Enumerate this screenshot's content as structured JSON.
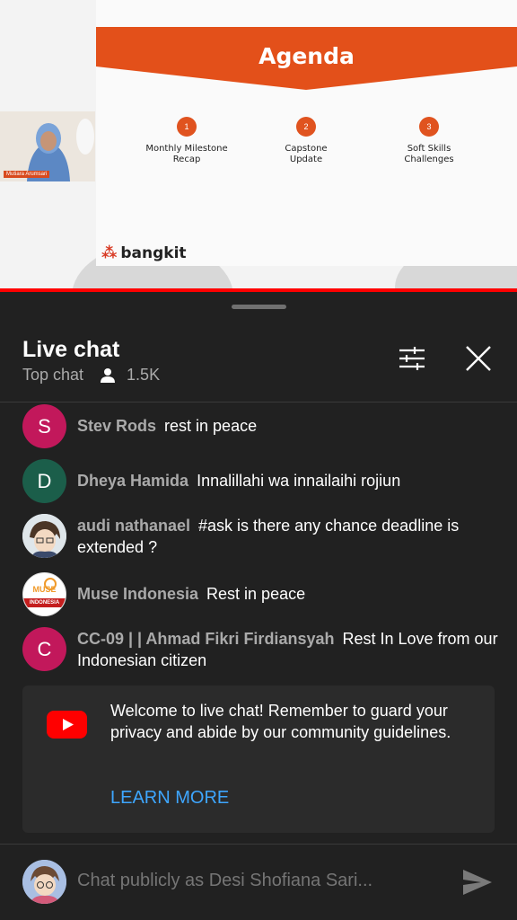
{
  "video": {
    "slide_title": "Agenda",
    "agenda_items": [
      {
        "num": "1",
        "label_line1": "Monthly Milestone",
        "label_line2": "Recap"
      },
      {
        "num": "2",
        "label_line1": "Capstone",
        "label_line2": "Update"
      },
      {
        "num": "3",
        "label_line1": "Soft Skills",
        "label_line2": "Challenges"
      }
    ],
    "brand_logo": "bangkit",
    "presenter_name": "Mutiara Arumsari",
    "accent_color": "#e0531f",
    "progress_color": "#ff0000"
  },
  "chat": {
    "title": "Live chat",
    "mode": "Top chat",
    "viewer_icon": "person-icon",
    "viewers": "1.5K",
    "filter_icon": "tune-icon",
    "close_icon": "close-icon",
    "messages": [
      {
        "initial": "S",
        "avatar_color": "#c2185b",
        "author": "Stev Rods",
        "text": "rest in peace"
      },
      {
        "initial": "D",
        "avatar_color": "#1b5e4a",
        "author": "Dheya Hamida",
        "text": "Innalillahi wa innailaihi rojiun"
      },
      {
        "initial": "",
        "avatar_color": "#cfd8dc",
        "author": "audi nathanael",
        "text": "#ask is there any chance deadline is extended ?"
      },
      {
        "initial": "MUSE",
        "avatar_color": "#ffffff",
        "author": "Muse Indonesia",
        "text": "Rest in peace",
        "avatar_sub": "INDONESIA"
      },
      {
        "initial": "C",
        "avatar_color": "#c2185b",
        "author": "CC-09 | | Ahmad Fikri Firdiansyah",
        "text": "Rest In Love from our Indonesian citizen"
      }
    ],
    "welcome": {
      "icon": "youtube-icon",
      "text": "Welcome to live chat! Remember to guard your privacy and abide by our community guidelines.",
      "link": "LEARN MORE"
    },
    "input_placeholder": "Chat publicly as Desi Shofiana Sari...",
    "send_icon": "send-icon"
  }
}
